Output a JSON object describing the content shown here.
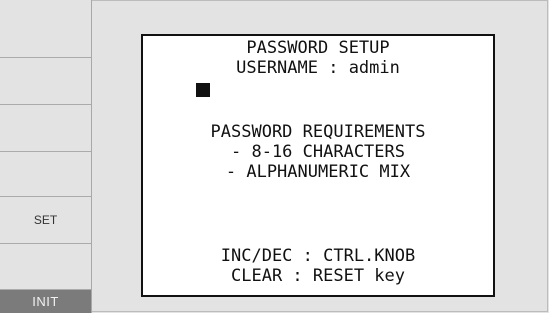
{
  "softkeys": [
    {
      "label": ""
    },
    {
      "label": ""
    },
    {
      "label": ""
    },
    {
      "label": ""
    },
    {
      "label": "SET"
    },
    {
      "label": ""
    },
    {
      "label": "INIT"
    }
  ],
  "screen": {
    "title": "PASSWORD SETUP",
    "username_line": "USERNAME : admin",
    "requirements_heading": "PASSWORD REQUIREMENTS",
    "requirement_1": "- 8-16 CHARACTERS",
    "requirement_2": "- ALPHANUMERIC MIX",
    "help_line_1": "INC/DEC : CTRL.KNOB",
    "help_line_2": "CLEAR : RESET key"
  }
}
